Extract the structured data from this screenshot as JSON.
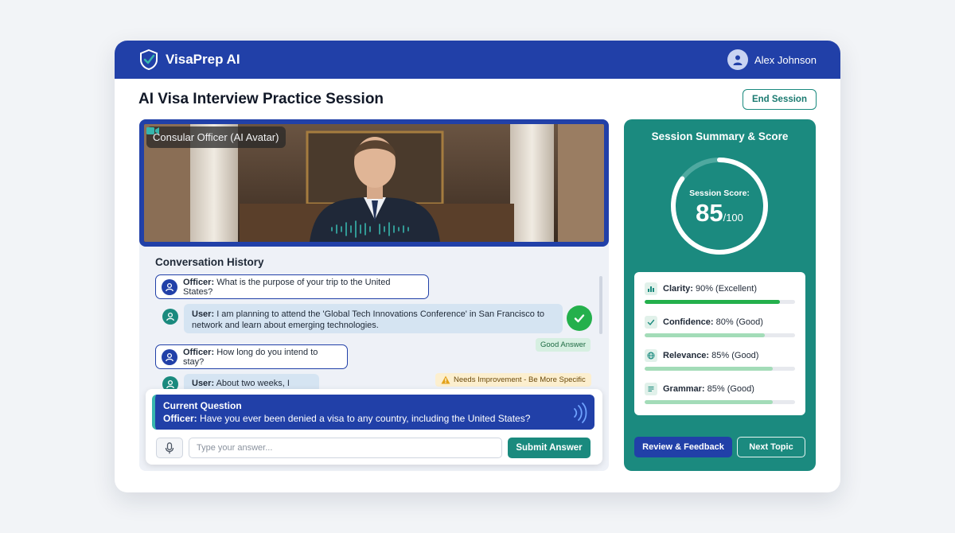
{
  "app": {
    "brand": "VisaPrep AI",
    "user_name": "Alex Johnson",
    "page_title": "AI Visa Interview Practice Session",
    "end_session_label": "End Session"
  },
  "video": {
    "label": "Consular Officer (AI Avatar)"
  },
  "conversation": {
    "title": "Conversation History",
    "messages": [
      {
        "role": "Officer:",
        "text": "What is the purpose of your trip to the United States?"
      },
      {
        "role": "User:",
        "text": "I am planning to attend the 'Global Tech Innovations Conference' in San Francisco to network and learn about emerging technologies.",
        "badge": "Good Answer"
      },
      {
        "role": "Officer:",
        "text": "How long do you intend to stay?"
      },
      {
        "role": "User:",
        "text": "About two weeks, I think.",
        "badge": "Needs Improvement - Be More Specific"
      }
    ]
  },
  "current_question": {
    "title": "Current Question",
    "role": "Officer:",
    "text": "Have you ever been denied a visa to any country, including the United States?"
  },
  "composer": {
    "placeholder": "Type your answer...",
    "submit_label": "Submit Answer"
  },
  "summary": {
    "title": "Session Summary & Score",
    "score_label": "Session Score:",
    "score": 85,
    "score_text": "85",
    "score_max": "/100",
    "metrics": [
      {
        "name": "Clarity:",
        "detail": "90% (Excellent)",
        "value": 90,
        "color": "#24b04c",
        "icon": "bar-chart-icon"
      },
      {
        "name": "Confidence:",
        "detail": "80% (Good)",
        "value": 80,
        "color": "#a3dcb8",
        "icon": "check-icon"
      },
      {
        "name": "Relevance:",
        "detail": "85% (Good)",
        "value": 85,
        "color": "#a3dcb8",
        "icon": "globe-icon"
      },
      {
        "name": "Grammar:",
        "detail": "85% (Good)",
        "value": 85,
        "color": "#a3dcb8",
        "icon": "text-lines-icon"
      }
    ],
    "review_label": "Review & Feedback",
    "next_label": "Next Topic"
  },
  "colors": {
    "primary": "#2140a8",
    "teal": "#1a8a7e",
    "success": "#24b04c",
    "warning_bg": "#fcefcf"
  }
}
